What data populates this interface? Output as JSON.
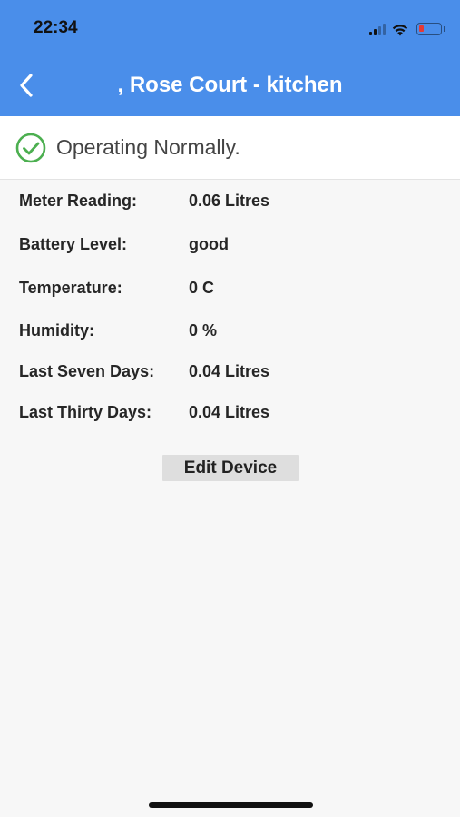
{
  "status_bar": {
    "time": "22:34",
    "icons": [
      "cellular-signal-icon",
      "wifi-icon",
      "battery-low-icon"
    ],
    "battery_color": "#e53935"
  },
  "app_bar": {
    "title": ", Rose Court - kitchen",
    "back_icon": "chevron-left-icon",
    "color": "#4a8eea"
  },
  "device_status": {
    "icon": "check-circle-icon",
    "icon_color": "#4caf50",
    "text": "Operating Normally."
  },
  "details": [
    {
      "label": "Meter Reading:",
      "value": "0.06 Litres"
    },
    {
      "label": "Battery Level:",
      "value": "good"
    },
    {
      "label": "Temperature:",
      "value": "0 C"
    },
    {
      "label": "Humidity:",
      "value": "0 %"
    },
    {
      "label": "Last Seven Days:",
      "value": "0.04 Litres"
    },
    {
      "label": "Last Thirty Days:",
      "value": "0.04 Litres"
    }
  ],
  "actions": {
    "edit_label": "Edit Device"
  }
}
